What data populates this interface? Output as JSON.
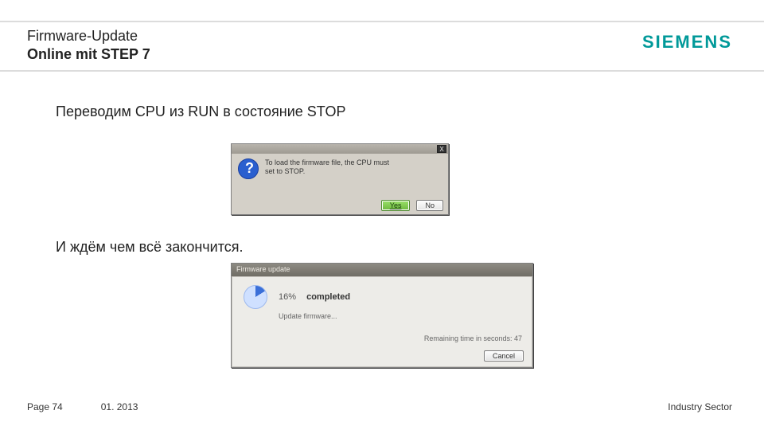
{
  "header": {
    "title_line1": "Firmware-Update",
    "title_line2": "Online mit STEP 7",
    "logo": "SIEMENS"
  },
  "content": {
    "text1": "Переводим  CPU из RUN в состояние STOP",
    "text2": "И ждём чем всё закончится."
  },
  "dialog_confirm": {
    "message_line1": "To load the firmware file, the CPU must",
    "message_line2": "set to STOP.",
    "yes_label": "Yes",
    "no_label": "No",
    "close_label": "X"
  },
  "dialog_progress": {
    "title": "Firmware update",
    "percent_value": "16%",
    "percent_word": "completed",
    "status_line": "Update firmware...",
    "remaining": "Remaining time in seconds: 47",
    "cancel_label": "Cancel"
  },
  "footer": {
    "page": "Page 74",
    "date": "01. 2013",
    "sector": "Industry Sector"
  }
}
